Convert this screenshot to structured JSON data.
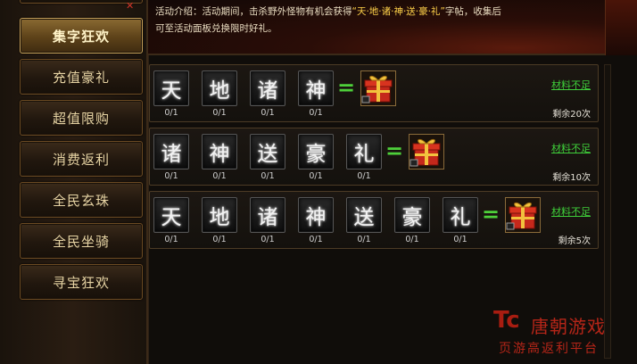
{
  "sidebar": {
    "items": [
      {
        "label": "集字狂欢",
        "active": true
      },
      {
        "label": "充值豪礼"
      },
      {
        "label": "超值限购"
      },
      {
        "label": "消费返利"
      },
      {
        "label": "全民玄珠"
      },
      {
        "label": "全民坐骑"
      },
      {
        "label": "寻宝狂欢"
      }
    ]
  },
  "banner": {
    "line1_prefix": "活动介绍：活动期间，击杀野外怪物有机会获得",
    "line1_highlight": "“天·地·诸·神·送·豪·礼”",
    "line1_suffix": "字帖，收集后",
    "line2": "可至活动面板兑换限时好礼。"
  },
  "rows": [
    {
      "chars": [
        "天",
        "地",
        "诸",
        "神"
      ],
      "counts": [
        "0/1",
        "0/1",
        "0/1",
        "0/1"
      ],
      "equals": "=",
      "reward_icon": "gift-box-icon",
      "status": "材料不足",
      "remaining": "剩余20次"
    },
    {
      "chars": [
        "诸",
        "神",
        "送",
        "豪",
        "礼"
      ],
      "counts": [
        "0/1",
        "0/1",
        "0/1",
        "0/1",
        "0/1"
      ],
      "equals": "=",
      "reward_icon": "gift-box-icon",
      "status": "材料不足",
      "remaining": "剩余10次"
    },
    {
      "chars": [
        "天",
        "地",
        "诸",
        "神",
        "送",
        "豪",
        "礼"
      ],
      "counts": [
        "0/1",
        "0/1",
        "0/1",
        "0/1",
        "0/1",
        "0/1",
        "0/1"
      ],
      "equals": "=",
      "reward_icon": "gift-box-icon",
      "status": "材料不足",
      "remaining": "剩余5次"
    }
  ],
  "watermark": {
    "logo": "Tc",
    "name": "唐朝游戏",
    "sub": "页游高返利平台"
  },
  "colors": {
    "accent_green": "#3fcf3a",
    "highlight_yellow": "#ffd24a",
    "frame_gold": "#c9a35a",
    "watermark_red": "#c7281a"
  }
}
